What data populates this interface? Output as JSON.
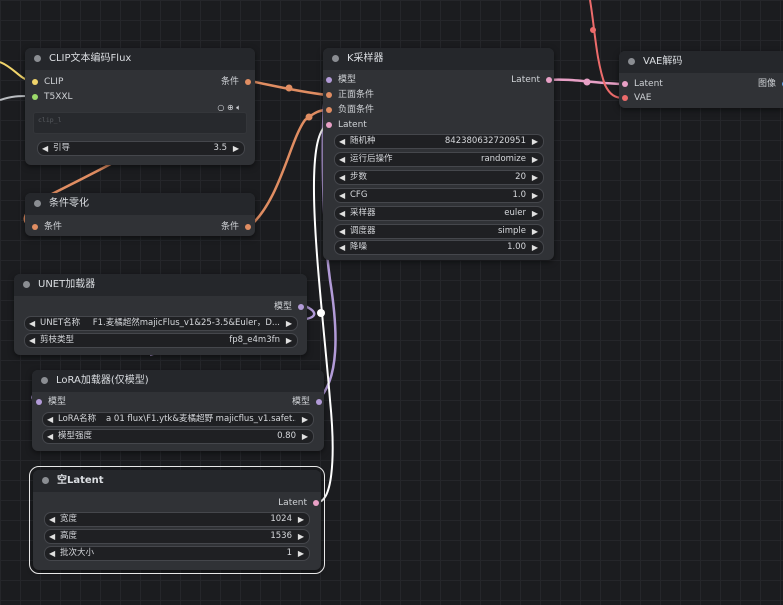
{
  "colors": {
    "clip": "#f0d46b",
    "t5": "#9cda6a",
    "cond": "#e08d62",
    "model": "#b29bd8",
    "latent": "#e8a0c6",
    "vae": "#ec6b6b",
    "image": "#62a0e8",
    "white": "#ffffff"
  },
  "clip_node": {
    "title": "CLIP文本编码Flux",
    "inputs": [
      "CLIP",
      "T5XXL"
    ],
    "output": "条件",
    "clip_l_placeholder": "clip_l",
    "icons": [
      "circle-icon",
      "target-icon",
      "speaker-icon"
    ],
    "guidance": {
      "label": "引导",
      "value": "3.5"
    }
  },
  "cond_zero": {
    "title": "条件零化",
    "input": "条件",
    "output": "条件"
  },
  "unet": {
    "title": "UNET加载器",
    "output": "模型",
    "name": {
      "label": "UNET名称",
      "value": "F1.麦橘超然majicFlus_v1&25-3.5&Euler，D..."
    },
    "dtype": {
      "label": "剪枝类型",
      "value": "fp8_e4m3fn"
    }
  },
  "lora": {
    "title": "LoRA加载器(仅模型)",
    "input": "模型",
    "output": "模型",
    "name": {
      "label": "LoRA名称",
      "value": "a 01 flux\\F1.ytk&麦橘超野 majicflus_v1.safet..."
    },
    "strength": {
      "label": "模型强度",
      "value": "0.80"
    }
  },
  "empty_latent": {
    "title": "空Latent",
    "output": "Latent",
    "width": {
      "label": "宽度",
      "value": "1024"
    },
    "height": {
      "label": "高度",
      "value": "1536"
    },
    "batch": {
      "label": "批次大小",
      "value": "1"
    }
  },
  "ksampler": {
    "title": "K采样器",
    "inputs": [
      "模型",
      "正面条件",
      "负面条件",
      "Latent"
    ],
    "output": "Latent",
    "widgets": [
      {
        "label": "随机种",
        "value": "842380632720951"
      },
      {
        "label": "运行后操作",
        "value": "randomize"
      },
      {
        "label": "步数",
        "value": "20"
      },
      {
        "label": "CFG",
        "value": "1.0"
      },
      {
        "label": "采样器",
        "value": "euler"
      },
      {
        "label": "调度器",
        "value": "simple"
      },
      {
        "label": "降噪",
        "value": "1.00"
      }
    ]
  },
  "vae_decode": {
    "title": "VAE解码",
    "inputs": [
      "Latent",
      "VAE"
    ],
    "output": "图像"
  }
}
